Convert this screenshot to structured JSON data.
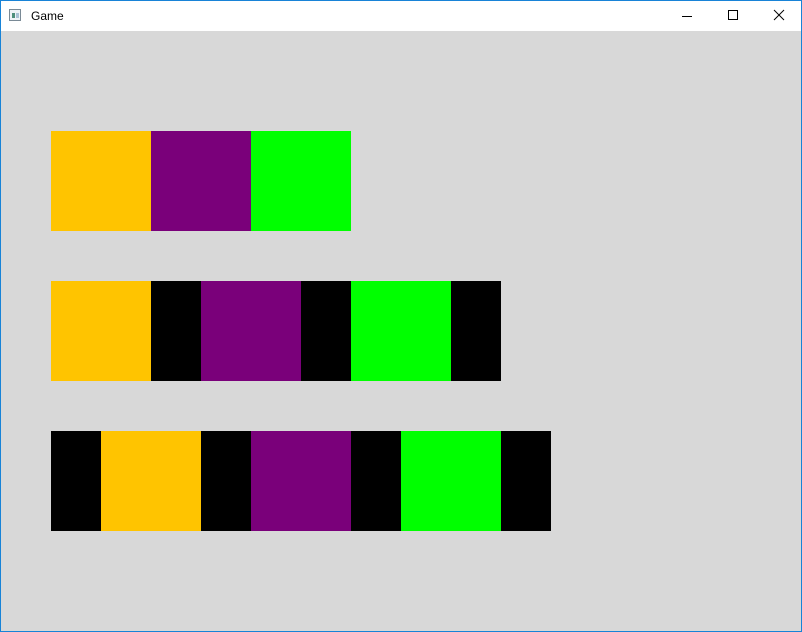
{
  "window": {
    "title": "Game",
    "title_icon": "app-window-icon",
    "controls": [
      "minimize-icon",
      "maximize-icon",
      "close-icon"
    ]
  },
  "colors": {
    "orange": "#ffc400",
    "purple": "#7a007a",
    "green": "#00ff00",
    "black": "#000000",
    "background": "#d8d8d8"
  },
  "rows": [
    {
      "blocks": [
        "orange",
        "purple",
        "green"
      ]
    },
    {
      "blocks": [
        "orange",
        "black-narrow",
        "purple",
        "black-narrow",
        "green",
        "black-narrow"
      ]
    },
    {
      "blocks": [
        "black-narrow",
        "orange",
        "black-narrow",
        "purple",
        "black-narrow",
        "green",
        "black-narrow"
      ]
    }
  ]
}
